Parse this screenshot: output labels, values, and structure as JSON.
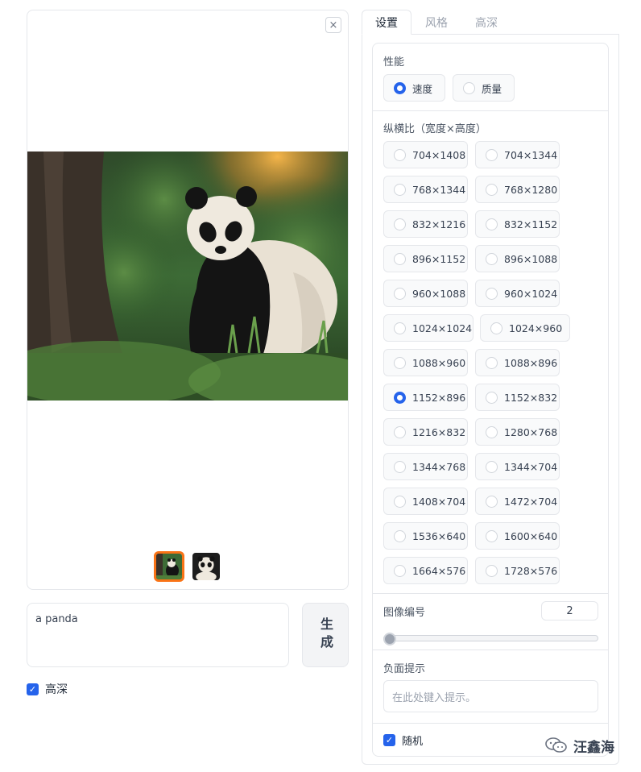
{
  "gallery": {
    "close_icon": "×",
    "thumbnails": [
      {
        "name": "panda-thumb-1",
        "selected": true
      },
      {
        "name": "panda-thumb-2",
        "selected": false
      }
    ]
  },
  "prompt": {
    "value": "a panda"
  },
  "generate_button": {
    "label": "生成"
  },
  "left_checkbox": {
    "label": "高深",
    "checked": true
  },
  "tabs": [
    {
      "label": "设置",
      "active": true
    },
    {
      "label": "风格",
      "active": false
    },
    {
      "label": "高深",
      "active": false
    }
  ],
  "performance": {
    "label": "性能",
    "options": [
      {
        "label": "速度",
        "checked": true
      },
      {
        "label": "质量",
        "checked": false
      }
    ]
  },
  "aspect_ratio": {
    "label": "纵横比（宽度×高度）",
    "options": [
      {
        "label": "704×1408",
        "checked": false
      },
      {
        "label": "704×1344",
        "checked": false
      },
      {
        "label": "768×1344",
        "checked": false
      },
      {
        "label": "768×1280",
        "checked": false
      },
      {
        "label": "832×1216",
        "checked": false
      },
      {
        "label": "832×1152",
        "checked": false
      },
      {
        "label": "896×1152",
        "checked": false
      },
      {
        "label": "896×1088",
        "checked": false
      },
      {
        "label": "960×1088",
        "checked": false
      },
      {
        "label": "960×1024",
        "checked": false
      },
      {
        "label": "1024×1024",
        "checked": false
      },
      {
        "label": "1024×960",
        "checked": false
      },
      {
        "label": "1088×960",
        "checked": false
      },
      {
        "label": "1088×896",
        "checked": false
      },
      {
        "label": "1152×896",
        "checked": true
      },
      {
        "label": "1152×832",
        "checked": false
      },
      {
        "label": "1216×832",
        "checked": false
      },
      {
        "label": "1280×768",
        "checked": false
      },
      {
        "label": "1344×768",
        "checked": false
      },
      {
        "label": "1344×704",
        "checked": false
      },
      {
        "label": "1408×704",
        "checked": false
      },
      {
        "label": "1472×704",
        "checked": false
      },
      {
        "label": "1536×640",
        "checked": false
      },
      {
        "label": "1600×640",
        "checked": false
      },
      {
        "label": "1664×576",
        "checked": false
      },
      {
        "label": "1728×576",
        "checked": false
      }
    ]
  },
  "image_count": {
    "label": "图像编号",
    "value": "2",
    "slider_fraction": 0.0
  },
  "negative_prompt": {
    "label": "负面提示",
    "placeholder": "在此处键入提示。"
  },
  "random_checkbox": {
    "label": "随机",
    "checked": true
  },
  "watermark": {
    "text": "汪鑫海",
    "icon": "wechat-icon"
  },
  "colors": {
    "accent": "#2563eb",
    "thumb_border": "#f97316"
  }
}
